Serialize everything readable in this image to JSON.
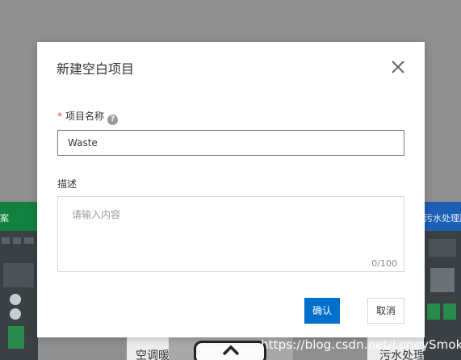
{
  "background": {
    "left_card_title": "案",
    "right_card_title": "污水处理厂",
    "bottom_label_left": "空调暖通",
    "bottom_label_right": "污水处理",
    "watermark": "https://blog.csdn.net/LoneySmoke",
    "colors": {
      "left_bar": "#12803f",
      "right_bar": "#1d5fb3",
      "overlay": "#8f8f8f"
    }
  },
  "dialog": {
    "title": "新建空白项目",
    "close_icon": "close-icon",
    "name_field": {
      "required_mark": "*",
      "label": "项目名称",
      "help_icon": "question-circle-icon",
      "value": "Waste"
    },
    "description_field": {
      "label": "描述",
      "placeholder": "请输入内容",
      "counter": "0/100"
    },
    "buttons": {
      "confirm": "确认",
      "cancel": "取消"
    },
    "colors": {
      "primary": "#0070cc",
      "required": "#e0523f"
    }
  }
}
